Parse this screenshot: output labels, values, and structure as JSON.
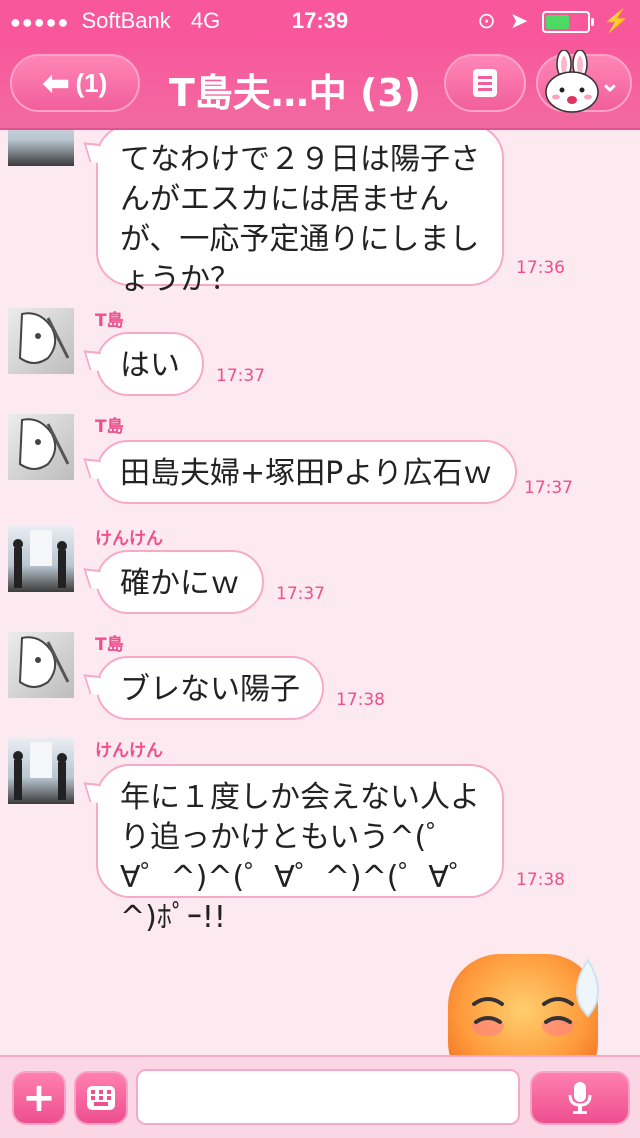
{
  "status_bar": {
    "signal": "●●●●●",
    "carrier": "SoftBank",
    "network": "4G",
    "time": "17:39",
    "battery_level": 0.65
  },
  "nav": {
    "back_label": "(1)",
    "title": "T島夫…中 (3)"
  },
  "messages": [
    {
      "sender": "",
      "text": "てなわけで２９日は陽子さんがエスカには居ませんが、一応予定通りにしましょうか？",
      "time": "17:36",
      "avatar": "kenken"
    },
    {
      "sender": "T島",
      "text": "はい",
      "time": "17:37",
      "avatar": "tshima"
    },
    {
      "sender": "T島",
      "text": "田島夫婦+塚田Pより広石ｗ",
      "time": "17:37",
      "avatar": "tshima"
    },
    {
      "sender": "けんけん",
      "text": "確かにｗ",
      "time": "17:37",
      "avatar": "kenken"
    },
    {
      "sender": "T島",
      "text": "ブレない陽子",
      "time": "17:38",
      "avatar": "tshima"
    },
    {
      "sender": "けんけん",
      "text": "年に１度しか会えない人より追っかけともいう^(゜∀゜^)^(゜∀゜^)^(゜∀゜^)ﾎﾟｰ!!",
      "time": "17:38",
      "avatar": "kenken"
    }
  ],
  "input": {
    "placeholder": ""
  },
  "colors": {
    "brand": "#f8589b",
    "background": "#fde9f0",
    "bubble_border": "#f7aac8"
  },
  "icons": [
    "back-arrow-icon",
    "menu-list-icon",
    "bunny-profile-icon",
    "plus-icon",
    "keyboard-icon",
    "microphone-icon"
  ]
}
